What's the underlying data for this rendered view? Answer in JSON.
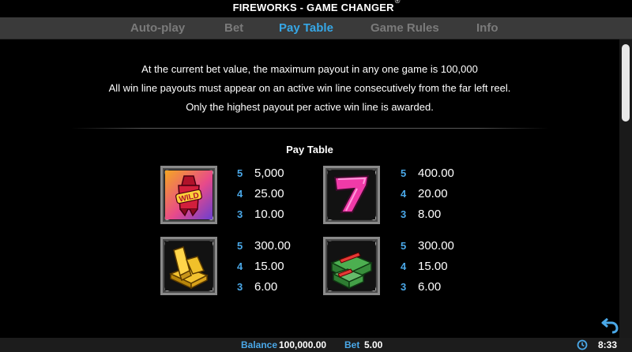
{
  "header": {
    "title": "FIREWORKS - GAME CHANGER",
    "title_mark": "®"
  },
  "tabs": [
    {
      "label": "Auto-play"
    },
    {
      "label": "Bet"
    },
    {
      "label": "Pay Table"
    },
    {
      "label": "Game Rules"
    },
    {
      "label": "Info"
    }
  ],
  "active_tab": "Pay Table",
  "intro": [
    "At the current bet value, the maximum payout in any one game is 100,000",
    "All win line payouts must appear on an active win line consecutively from the far left reel.",
    "Only the highest payout per active win line is awarded."
  ],
  "paytable": {
    "title": "Pay Table",
    "symbols": [
      {
        "icon": "wild-firework-icon",
        "wild_text": "WILD",
        "payouts": [
          {
            "count": "5",
            "amount": "5,000"
          },
          {
            "count": "4",
            "amount": "25.00"
          },
          {
            "count": "3",
            "amount": "10.00"
          }
        ]
      },
      {
        "icon": "lucky-seven-icon",
        "payouts": [
          {
            "count": "5",
            "amount": "400.00"
          },
          {
            "count": "4",
            "amount": "20.00"
          },
          {
            "count": "3",
            "amount": "8.00"
          }
        ]
      },
      {
        "icon": "gold-bars-icon",
        "payouts": [
          {
            "count": "5",
            "amount": "300.00"
          },
          {
            "count": "4",
            "amount": "15.00"
          },
          {
            "count": "3",
            "amount": "6.00"
          }
        ]
      },
      {
        "icon": "cash-stacks-icon",
        "payouts": [
          {
            "count": "5",
            "amount": "300.00"
          },
          {
            "count": "4",
            "amount": "15.00"
          },
          {
            "count": "3",
            "amount": "6.00"
          }
        ]
      }
    ]
  },
  "footer": {
    "balance_label": "Balance",
    "balance_value": "100,000.00",
    "bet_label": "Bet",
    "bet_value": "5.00",
    "time": "8:33"
  },
  "colors": {
    "accent": "#36a7e6",
    "tab_inactive": "#7a7a7a",
    "tab_bar": "#3a3a3a",
    "background": "#000000"
  }
}
